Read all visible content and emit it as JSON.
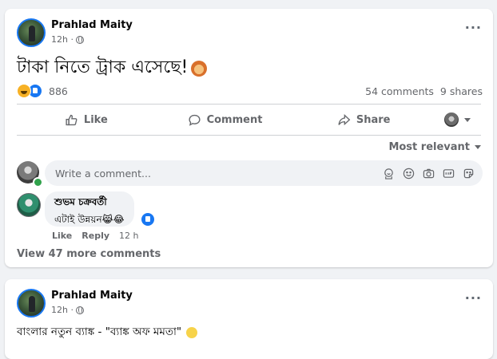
{
  "post1": {
    "author": "Prahlad Maity",
    "time": "12h ·",
    "text": "টাকা নিতে ট্রাক এসেছে!",
    "reaction_count": "886",
    "comments_count": "54 comments",
    "shares_count": "9 shares",
    "actions": {
      "like": "Like",
      "comment": "Comment",
      "share": "Share"
    },
    "sort_label": "Most relevant",
    "comment_placeholder": "Write a comment...",
    "comment": {
      "author": "শুভম চক্রবর্তী",
      "text": "এটাই উন্নয়ন😹😂",
      "like": "Like",
      "reply": "Reply",
      "time": "12 h"
    },
    "view_more": "View 47 more comments"
  },
  "post2": {
    "author": "Prahlad Maity",
    "time": "12h ·",
    "text": "বাংলার নতুন ব্যাঙ্ক - \"ব্যাঙ্ক অফ মমতা\""
  },
  "colors": {
    "accent": "#1877f2",
    "background": "#f0f2f5",
    "secondary_text": "#65676b",
    "online": "#31a24c"
  },
  "icons": [
    "more-options-icon",
    "globe-icon",
    "lion-emoji-icon",
    "haha-reaction-icon",
    "like-reaction-icon",
    "thumbs-up-icon",
    "comment-bubble-icon",
    "share-arrow-icon",
    "caret-down-icon",
    "sticker-icon",
    "emoji-icon",
    "camera-icon",
    "gif-icon",
    "avatar-sticker-icon",
    "smile-emoji-icon"
  ]
}
